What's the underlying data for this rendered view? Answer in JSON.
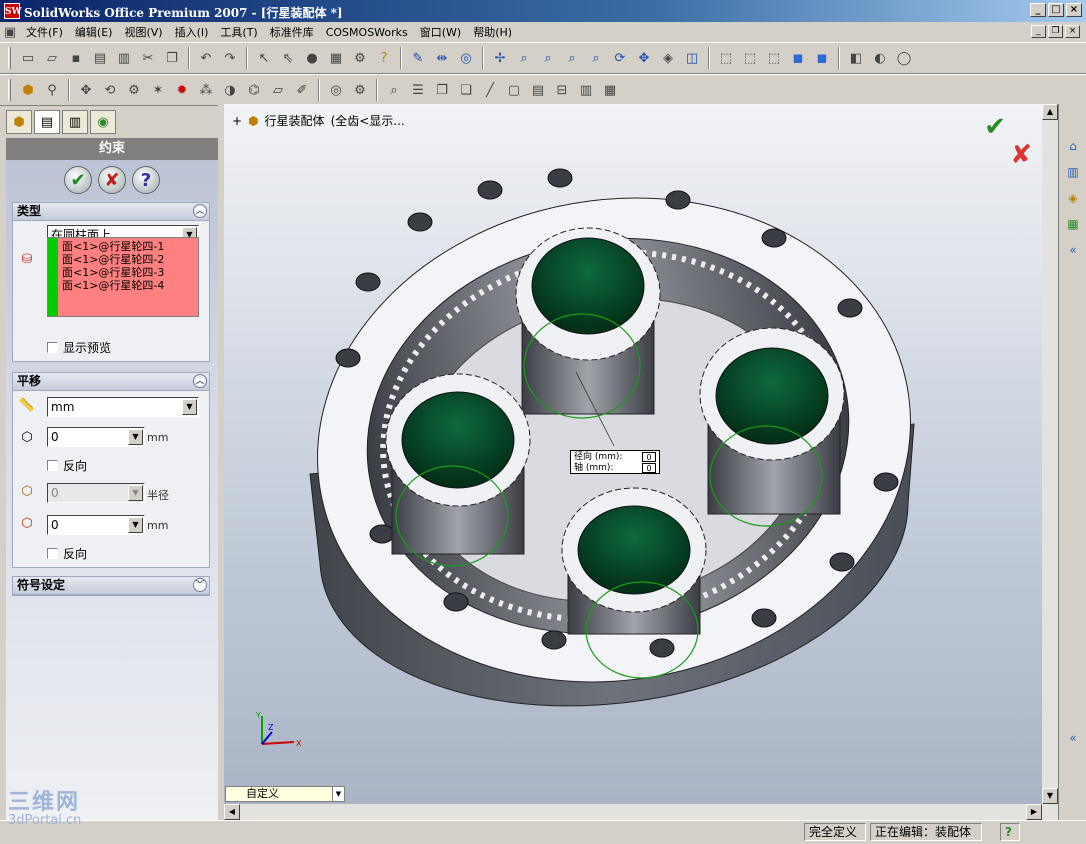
{
  "window": {
    "title": "SolidWorks Office Premium 2007 - [行星装配体 *]",
    "logo_text": "SW",
    "controls": [
      "_",
      "□",
      "×"
    ]
  },
  "menu": {
    "items": [
      "文件(F)",
      "编辑(E)",
      "视图(V)",
      "插入(I)",
      "工具(T)",
      "标准件库",
      "COSMOSWorks",
      "窗口(W)",
      "帮助(H)"
    ],
    "mdi_controls": [
      "_",
      "❐",
      "×"
    ]
  },
  "property_manager": {
    "title": "约束",
    "ok_label": "✔",
    "cancel_label": "✘",
    "help_label": "?",
    "type_group": {
      "title": "类型",
      "type_value": "在圆柱面上",
      "selections": [
        "面<1>@行星轮四-1",
        "面<1>@行星轮四-2",
        "面<1>@行星轮四-3",
        "面<1>@行星轮四-4"
      ],
      "preview_label": "显示预览"
    },
    "translate_group": {
      "title": "平移",
      "unit_value": "mm",
      "offset1_value": "0",
      "offset1_unit": "mm",
      "reverse1_label": "反向",
      "radius_value": "0",
      "radius_unit": "半径",
      "offset2_value": "0",
      "offset2_unit": "mm",
      "reverse2_label": "反向"
    },
    "symbol_group": {
      "title": "符号设定"
    }
  },
  "viewport": {
    "tree_node": "行星装配体",
    "tree_suffix": "(全齿<显示...",
    "dim_radial_label": "径向 (mm):",
    "dim_radial_value": "0",
    "dim_axial_label": "轴 (mm):",
    "dim_axial_value": "0",
    "view_combo": "自定义",
    "triad_x": "X",
    "triad_y": "Y",
    "triad_z": "Z"
  },
  "statusbar": {
    "state": "完全定义",
    "editing": "正在编辑：装配体",
    "help": "?"
  },
  "watermark": {
    "line1": "三维网",
    "line2": "3dPortal.cn"
  },
  "colors": {
    "title_bar": "#0a246a",
    "gear_body": "#5a5f66",
    "gear_top": "#f4f5f8",
    "bore": "#0b4a2e",
    "selection_green": "#00cc00",
    "selection_box": "#ff8080"
  }
}
